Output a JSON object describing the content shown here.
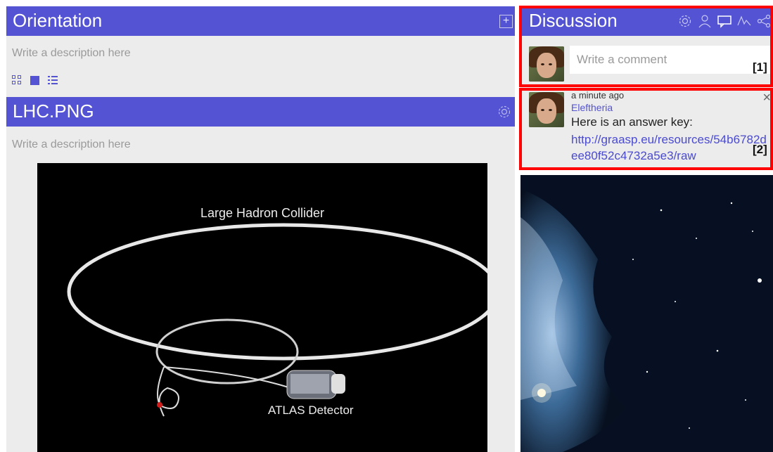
{
  "orientation": {
    "title": "Orientation",
    "description_placeholder": "Write a description here",
    "add_icon": "plus-square-icon",
    "view_modes": [
      "grid-icon",
      "single-view-icon",
      "list-icon"
    ]
  },
  "resource": {
    "title": "LHC.PNG",
    "description_placeholder": "Write a description here",
    "settings_icon": "gear-icon",
    "image": {
      "title": "Large Hadron Collider",
      "label": "ATLAS Detector"
    }
  },
  "discussion": {
    "title": "Discussion",
    "toolbar_icons": [
      "gear-icon",
      "user-icon",
      "comment-icon",
      "activity-icon",
      "share-icon"
    ],
    "comment_placeholder": "Write a comment",
    "comments": [
      {
        "time": "a minute ago",
        "author": "Eleftheria",
        "text": "Here is an answer key:",
        "link": "http://graasp.eu/resources/54b6782dee80f52c4732a5e3/raw"
      }
    ]
  },
  "annotations": {
    "mark1": "[1]",
    "mark2": "[2]"
  },
  "colors": {
    "accent": "#5353d3",
    "panel_bg": "#ececec",
    "highlight": "#ff0000"
  }
}
